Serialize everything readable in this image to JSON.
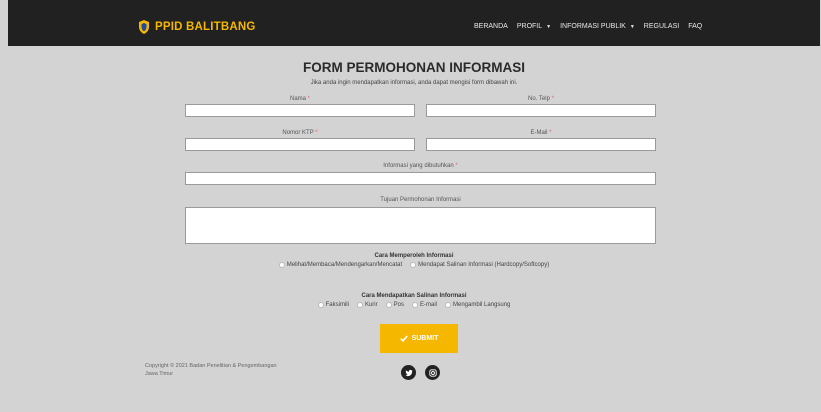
{
  "brand": {
    "name": "PPID BALITBANG"
  },
  "nav": {
    "items": [
      {
        "label": "BERANDA"
      },
      {
        "label": "PROFIL"
      },
      {
        "label": "INFORMASI PUBLIK"
      },
      {
        "label": "REGULASI"
      },
      {
        "label": "FAQ"
      }
    ]
  },
  "form": {
    "title": "FORM PERMOHONAN INFORMASI",
    "subtitle": "Jika anda ingin mendapatkan informasi, anda dapat mengisi form dibawah ini.",
    "required_mark": "*",
    "fields": {
      "nama": {
        "label": "Nama",
        "value": ""
      },
      "telp": {
        "label": "No. Telp",
        "value": ""
      },
      "ktp": {
        "label": "Nomor KTP",
        "value": ""
      },
      "email": {
        "label": "E-Mail",
        "value": ""
      },
      "informasi": {
        "label": "Informasi yang dibutuhkan",
        "value": ""
      },
      "tujuan": {
        "label": "Tujuan Permohonan Informasi",
        "value": ""
      }
    },
    "cara_memperoleh": {
      "title": "Cara Memperoleh Informasi",
      "options": [
        "Melihat/Membaca/Mendengarkan/Mencatat",
        "Mendapat Salinan Informasi (Hardcopy/Softcopy)"
      ]
    },
    "cara_mendapatkan": {
      "title": "Cara Mendapatkan Salinan Informasi",
      "options": [
        "Faksimili",
        "Kurir",
        "Pos",
        "E-mail",
        "Mengambil Langsung"
      ]
    },
    "submit_label": "SUBMIT"
  },
  "footer": {
    "copyright_line1": "Copyright © 2021 Badan Penelitian & Pengembangan",
    "copyright_line2": "Jawa Timur"
  },
  "colors": {
    "accent": "#f5b700",
    "navbar": "#212121",
    "background": "#d3d3d3"
  }
}
